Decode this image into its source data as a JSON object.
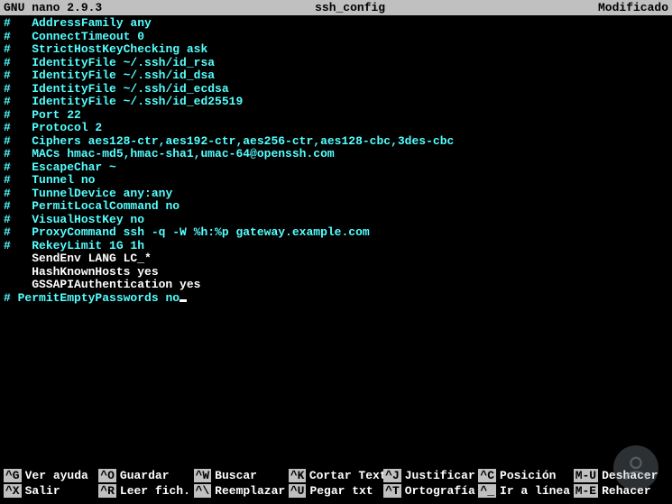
{
  "titlebar": {
    "app": "GNU nano 2.9.3",
    "filename": "ssh_config",
    "status": "Modificado"
  },
  "lines": [
    {
      "hash": "#",
      "text": "   AddressFamily any",
      "style": "comment"
    },
    {
      "hash": "#",
      "text": "   ConnectTimeout 0",
      "style": "comment"
    },
    {
      "hash": "#",
      "text": "   StrictHostKeyChecking ask",
      "style": "comment"
    },
    {
      "hash": "#",
      "text": "   IdentityFile ~/.ssh/id_rsa",
      "style": "comment"
    },
    {
      "hash": "#",
      "text": "   IdentityFile ~/.ssh/id_dsa",
      "style": "comment"
    },
    {
      "hash": "#",
      "text": "   IdentityFile ~/.ssh/id_ecdsa",
      "style": "comment"
    },
    {
      "hash": "#",
      "text": "   IdentityFile ~/.ssh/id_ed25519",
      "style": "comment"
    },
    {
      "hash": "#",
      "text": "   Port 22",
      "style": "comment"
    },
    {
      "hash": "#",
      "text": "   Protocol 2",
      "style": "comment"
    },
    {
      "hash": "#",
      "text": "   Ciphers aes128-ctr,aes192-ctr,aes256-ctr,aes128-cbc,3des-cbc",
      "style": "comment"
    },
    {
      "hash": "#",
      "text": "   MACs hmac-md5,hmac-sha1,umac-64@openssh.com",
      "style": "comment"
    },
    {
      "hash": "#",
      "text": "   EscapeChar ~",
      "style": "comment"
    },
    {
      "hash": "#",
      "text": "   Tunnel no",
      "style": "comment"
    },
    {
      "hash": "#",
      "text": "   TunnelDevice any:any",
      "style": "comment"
    },
    {
      "hash": "#",
      "text": "   PermitLocalCommand no",
      "style": "comment"
    },
    {
      "hash": "#",
      "text": "   VisualHostKey no",
      "style": "comment"
    },
    {
      "hash": "#",
      "text": "   ProxyCommand ssh -q -W %h:%p gateway.example.com",
      "style": "comment"
    },
    {
      "hash": "#",
      "text": "   RekeyLimit 1G 1h",
      "style": "comment"
    },
    {
      "hash": "",
      "text": "    SendEnv LANG LC_*",
      "style": "plain"
    },
    {
      "hash": "",
      "text": "    HashKnownHosts yes",
      "style": "plain"
    },
    {
      "hash": "",
      "text": "    GSSAPIAuthentication yes",
      "style": "plain"
    },
    {
      "hash": "#",
      "text": " PermitEmptyPasswords no",
      "style": "comment",
      "cursor": true
    }
  ],
  "shortcuts": [
    {
      "key": "^G",
      "label": "Ver ayuda"
    },
    {
      "key": "^O",
      "label": "Guardar"
    },
    {
      "key": "^W",
      "label": "Buscar"
    },
    {
      "key": "^K",
      "label": "Cortar Text"
    },
    {
      "key": "^J",
      "label": "Justificar"
    },
    {
      "key": "^C",
      "label": "Posición"
    },
    {
      "key": "M-U",
      "label": "Deshacer"
    },
    {
      "key": "^X",
      "label": "Salir"
    },
    {
      "key": "^R",
      "label": "Leer fich."
    },
    {
      "key": "^\\",
      "label": "Reemplazar"
    },
    {
      "key": "^U",
      "label": "Pegar txt"
    },
    {
      "key": "^T",
      "label": "Ortografía"
    },
    {
      "key": "^_",
      "label": "Ir a línea"
    },
    {
      "key": "M-E",
      "label": "Rehacer"
    }
  ]
}
